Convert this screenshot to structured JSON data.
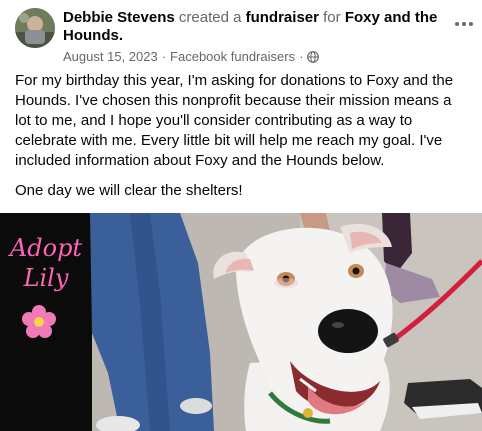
{
  "post": {
    "author": "Debbie Stevens",
    "action": " created a ",
    "type": "fundraiser",
    "connector": " for ",
    "organization": "Foxy and the Hounds.",
    "date": "August 15, 2023",
    "dot1": "·",
    "source": "Facebook fundraisers",
    "dot2": "·",
    "privacy_icon": "globe-icon",
    "paragraphs": [
      "For my birthday this year, I'm asking for donations to Foxy and the Hounds. I've chosen this nonprofit because their mission means a lot to me, and I hope you'll consider contributing as a way to celebrate with me. Every little bit will help me reach my goal. I've included information about Foxy and the Hounds below.",
      "One day we will clear the shelters!"
    ]
  },
  "photo": {
    "sign_line1": "Adopt",
    "sign_line2": "Lily"
  },
  "colors": {
    "text": "#050505",
    "muted": "#65676b",
    "sign_pink": "#ff63b8",
    "leash": "#d41f3c"
  }
}
